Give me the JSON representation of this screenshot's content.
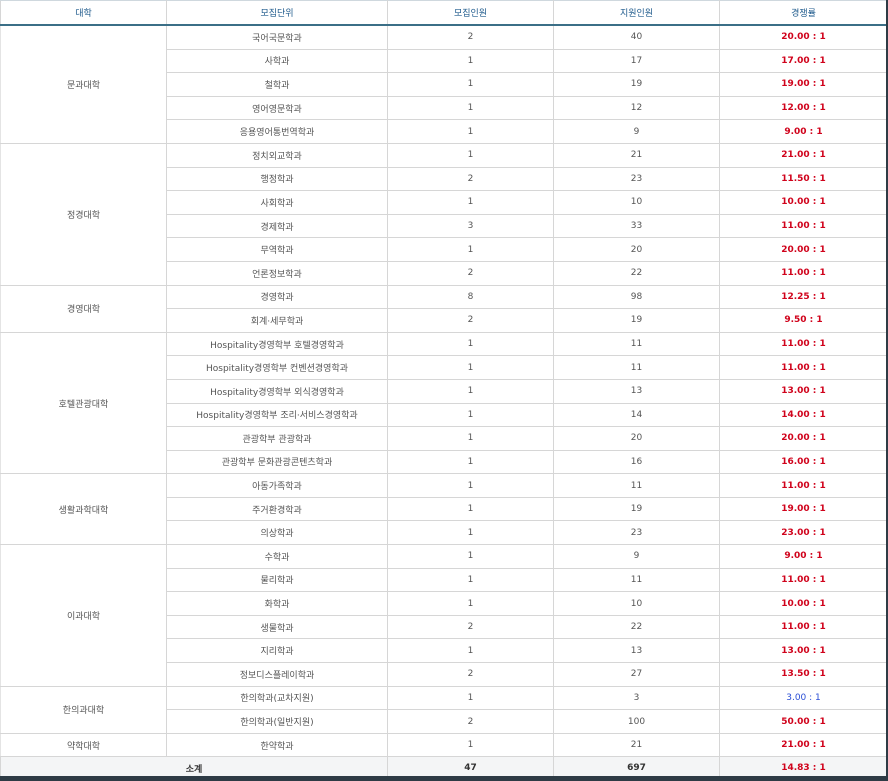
{
  "headers": {
    "college": "대학",
    "unit": "모집단위",
    "quota": "모집인원",
    "applicants": "지원인원",
    "ratio": "경쟁률"
  },
  "groups": [
    {
      "college": "문과대학",
      "rows": [
        {
          "unit": "국어국문학과",
          "quota": "2",
          "applicants": "40",
          "ratio": "20.00 : 1"
        },
        {
          "unit": "사학과",
          "quota": "1",
          "applicants": "17",
          "ratio": "17.00 : 1"
        },
        {
          "unit": "철학과",
          "quota": "1",
          "applicants": "19",
          "ratio": "19.00 : 1"
        },
        {
          "unit": "영어영문학과",
          "quota": "1",
          "applicants": "12",
          "ratio": "12.00 : 1"
        },
        {
          "unit": "응용영어통번역학과",
          "quota": "1",
          "applicants": "9",
          "ratio": "9.00 : 1"
        }
      ]
    },
    {
      "college": "정경대학",
      "rows": [
        {
          "unit": "정치외교학과",
          "quota": "1",
          "applicants": "21",
          "ratio": "21.00 : 1"
        },
        {
          "unit": "행정학과",
          "quota": "2",
          "applicants": "23",
          "ratio": "11.50 : 1"
        },
        {
          "unit": "사회학과",
          "quota": "1",
          "applicants": "10",
          "ratio": "10.00 : 1"
        },
        {
          "unit": "경제학과",
          "quota": "3",
          "applicants": "33",
          "ratio": "11.00 : 1"
        },
        {
          "unit": "무역학과",
          "quota": "1",
          "applicants": "20",
          "ratio": "20.00 : 1"
        },
        {
          "unit": "언론정보학과",
          "quota": "2",
          "applicants": "22",
          "ratio": "11.00 : 1"
        }
      ]
    },
    {
      "college": "경영대학",
      "rows": [
        {
          "unit": "경영학과",
          "quota": "8",
          "applicants": "98",
          "ratio": "12.25 : 1"
        },
        {
          "unit": "회계·세무학과",
          "quota": "2",
          "applicants": "19",
          "ratio": "9.50 : 1"
        }
      ]
    },
    {
      "college": "호텔관광대학",
      "rows": [
        {
          "unit": "Hospitality경영학부 호텔경영학과",
          "quota": "1",
          "applicants": "11",
          "ratio": "11.00 : 1"
        },
        {
          "unit": "Hospitality경영학부 컨벤션경영학과",
          "quota": "1",
          "applicants": "11",
          "ratio": "11.00 : 1"
        },
        {
          "unit": "Hospitality경영학부 외식경영학과",
          "quota": "1",
          "applicants": "13",
          "ratio": "13.00 : 1"
        },
        {
          "unit": "Hospitality경영학부 조리·서비스경영학과",
          "quota": "1",
          "applicants": "14",
          "ratio": "14.00 : 1"
        },
        {
          "unit": "관광학부 관광학과",
          "quota": "1",
          "applicants": "20",
          "ratio": "20.00 : 1"
        },
        {
          "unit": "관광학부 문화관광콘텐츠학과",
          "quota": "1",
          "applicants": "16",
          "ratio": "16.00 : 1"
        }
      ]
    },
    {
      "college": "생활과학대학",
      "rows": [
        {
          "unit": "아동가족학과",
          "quota": "1",
          "applicants": "11",
          "ratio": "11.00 : 1"
        },
        {
          "unit": "주거환경학과",
          "quota": "1",
          "applicants": "19",
          "ratio": "19.00 : 1"
        },
        {
          "unit": "의상학과",
          "quota": "1",
          "applicants": "23",
          "ratio": "23.00 : 1"
        }
      ]
    },
    {
      "college": "이과대학",
      "rows": [
        {
          "unit": "수학과",
          "quota": "1",
          "applicants": "9",
          "ratio": "9.00 : 1"
        },
        {
          "unit": "물리학과",
          "quota": "1",
          "applicants": "11",
          "ratio": "11.00 : 1"
        },
        {
          "unit": "화학과",
          "quota": "1",
          "applicants": "10",
          "ratio": "10.00 : 1"
        },
        {
          "unit": "생물학과",
          "quota": "2",
          "applicants": "22",
          "ratio": "11.00 : 1"
        },
        {
          "unit": "지리학과",
          "quota": "1",
          "applicants": "13",
          "ratio": "13.00 : 1"
        },
        {
          "unit": "정보디스플레이학과",
          "quota": "2",
          "applicants": "27",
          "ratio": "13.50 : 1"
        }
      ]
    },
    {
      "college": "한의과대학",
      "rows": [
        {
          "unit": "한의학과(교차지원)",
          "quota": "1",
          "applicants": "3",
          "ratio": "3.00 : 1",
          "ratio_color": "blue"
        },
        {
          "unit": "한의학과(일반지원)",
          "quota": "2",
          "applicants": "100",
          "ratio": "50.00 : 1"
        }
      ]
    },
    {
      "college": "약학대학",
      "rows": [
        {
          "unit": "한약학과",
          "quota": "1",
          "applicants": "21",
          "ratio": "21.00 : 1"
        }
      ]
    }
  ],
  "total": {
    "label": "소계",
    "quota": "47",
    "applicants": "697",
    "ratio": "14.83 : 1"
  },
  "colors": {
    "header_text": "#1e5a8c",
    "header_border": "#3b6f87",
    "ratio_red": "#d0021b",
    "ratio_blue": "#2b4fd6",
    "footer_bg": "#f4f5f6"
  }
}
